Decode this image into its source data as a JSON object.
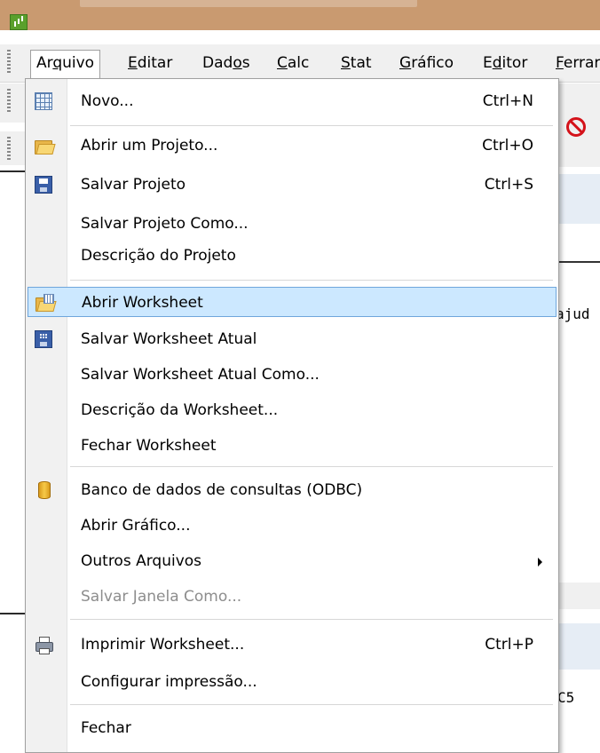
{
  "menubar": {
    "items": [
      {
        "label": "Arquivo",
        "active": true
      },
      {
        "label": "Editar"
      },
      {
        "label": "Dados"
      },
      {
        "label": "Calc"
      },
      {
        "label": "Stat"
      },
      {
        "label": "Gráfico"
      },
      {
        "label": "Editor"
      },
      {
        "label": "Ferrar"
      }
    ]
  },
  "background": {
    "side_text_1": "ajud",
    "side_text_2": "C5"
  },
  "dropdown": {
    "items": [
      {
        "label": "Novo...",
        "shortcut": "Ctrl+N",
        "icon": "new-worksheet-icon"
      },
      {
        "label": "Abrir um Projeto...",
        "shortcut": "Ctrl+O",
        "icon": "open-project-icon"
      },
      {
        "label": "Salvar Projeto",
        "shortcut": "Ctrl+S",
        "icon": "save-project-icon"
      },
      {
        "label": "Salvar Projeto Como...",
        "shortcut": ""
      },
      {
        "label": "Descrição do Projeto",
        "shortcut": ""
      },
      {
        "label": "Abrir Worksheet",
        "shortcut": "",
        "icon": "open-worksheet-icon",
        "highlighted": true
      },
      {
        "label": "Salvar Worksheet Atual",
        "shortcut": "",
        "icon": "save-worksheet-icon"
      },
      {
        "label": "Salvar Worksheet Atual Como...",
        "shortcut": ""
      },
      {
        "label": "Descrição da Worksheet...",
        "shortcut": ""
      },
      {
        "label": "Fechar Worksheet",
        "shortcut": ""
      },
      {
        "label": "Banco de dados de consultas (ODBC)",
        "shortcut": "",
        "icon": "database-icon"
      },
      {
        "label": "Abrir Gráfico...",
        "shortcut": ""
      },
      {
        "label": "Outros Arquivos",
        "shortcut": "",
        "submenu": true
      },
      {
        "label": "Salvar Janela Como...",
        "shortcut": "",
        "disabled": true
      },
      {
        "label": "Imprimir Worksheet...",
        "shortcut": "Ctrl+P",
        "icon": "printer-icon"
      },
      {
        "label": "Configurar impressão...",
        "shortcut": ""
      },
      {
        "label": "Fechar",
        "shortcut": ""
      }
    ]
  },
  "colors": {
    "titlebar": "#c99a70",
    "highlight_bg": "#cce8ff",
    "highlight_border": "#6fa6dc",
    "disabled_text": "#8d8d8d"
  }
}
